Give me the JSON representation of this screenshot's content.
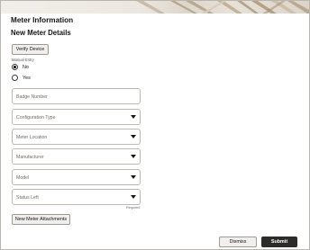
{
  "header": {
    "title": "Meter Information",
    "subtitle": "New Meter Details"
  },
  "verify_button": {
    "label": "Verify Device"
  },
  "manual_entry": {
    "label": "Manual Entry",
    "options": [
      {
        "label": "No",
        "selected": true
      },
      {
        "label": "Yes",
        "selected": false
      }
    ]
  },
  "fields": {
    "badge_number": {
      "placeholder": "Badge Number",
      "type": "text"
    },
    "configuration_type": {
      "placeholder": "Configuration Type",
      "type": "select"
    },
    "meter_location": {
      "placeholder": "Meter Location",
      "type": "select"
    },
    "manufacturer": {
      "placeholder": "Manufacturer",
      "type": "select"
    },
    "model": {
      "placeholder": "Model",
      "type": "select"
    },
    "status_left": {
      "placeholder": "Status Left",
      "type": "select",
      "helper": "Required"
    }
  },
  "attachments_button": {
    "label": "New Meter Attachments"
  },
  "footer": {
    "dismiss_label": "Dismiss",
    "submit_label": "Submit"
  },
  "colors": {
    "primary_button": "#2c2b29",
    "secondary_button": "#f1efed",
    "field_border": "#bdb9b3",
    "banner": "#ece7e0"
  }
}
